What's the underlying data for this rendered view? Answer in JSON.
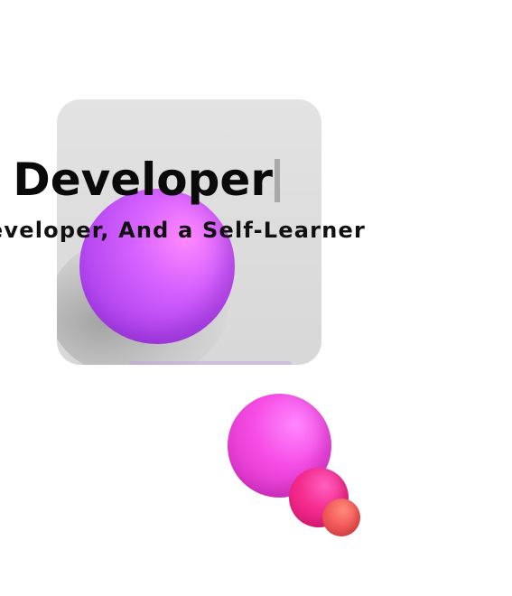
{
  "hero": {
    "headline": "Full Stack Web and Developer",
    "subheadline": "A Web Developer, App Developer, And a Self-Learner"
  },
  "colors": {
    "background": "#ffffff",
    "card": "#dcdcdc",
    "sphere_violet": "#c653ff",
    "sphere_magenta": "#f24fe3",
    "sphere_pink": "#f42c8e",
    "sphere_coral": "#f25a5a",
    "cursor": "#a9a9a9"
  }
}
